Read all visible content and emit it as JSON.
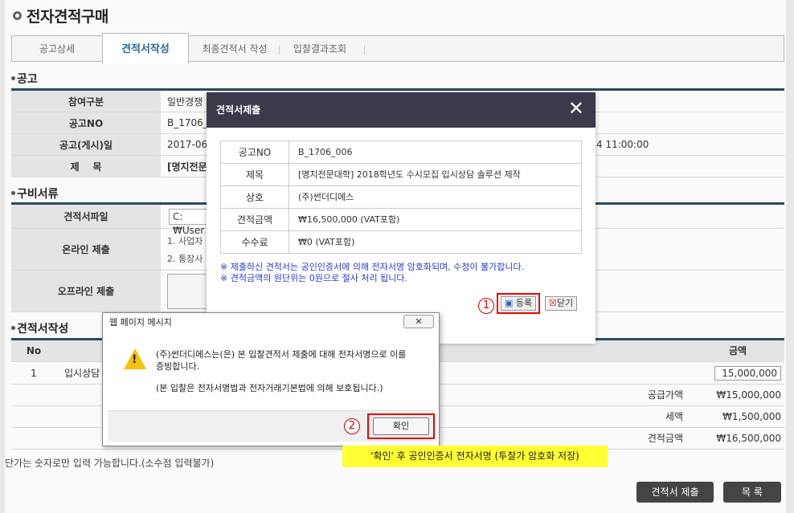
{
  "page": {
    "title": "전자견적구매"
  },
  "tabs": [
    {
      "label": "공고상세"
    },
    {
      "label": "견적서작성"
    },
    {
      "label": "최종견적서 작성"
    },
    {
      "label": "입찰결과조회"
    }
  ],
  "notice_section": {
    "heading": "공고",
    "rows": [
      {
        "label": "참여구분",
        "value": "일반경쟁"
      },
      {
        "label": "공고NO",
        "value": "B_1706_"
      },
      {
        "label": "공고(게시)일",
        "value": "2017-06",
        "extra": "4 11:00:00"
      },
      {
        "label": "제    목",
        "value": "[명지전문"
      }
    ]
  },
  "docs_section": {
    "heading": "구비서류",
    "rows": [
      {
        "label": "견적서파일",
        "value": "C:₩User"
      },
      {
        "label": "온라인 제출",
        "value1": "1. 사업자",
        "value2": "2. 통장사"
      },
      {
        "label": "오프라인 제출",
        "value": ""
      }
    ]
  },
  "quote_section": {
    "heading": "견적서작성",
    "col_no": "No",
    "col_amount": "금액",
    "row_no": "1",
    "row_item": "입시상담 솔",
    "row_amount": "15,000,000",
    "supply_label": "공급가액",
    "supply_value": "₩15,000,000",
    "tax_label": "세액",
    "tax_value": "₩1,500,000",
    "total_label": "견적금액",
    "total_value": "₩16,500,000"
  },
  "footnote": "단가는 숫자로만 입력 가능합니다.(소수점 입력불가)",
  "bottom_buttons": {
    "submit": "견적서 제출",
    "list": "목 록"
  },
  "modal": {
    "title": "견적서제출",
    "close": "✕",
    "rows": [
      {
        "label": "공고NO",
        "value": "B_1706_006"
      },
      {
        "label": "제목",
        "value": "[명지전문대학] 2018학년도 수시모집 입시상담 솔루션 제작"
      },
      {
        "label": "상호",
        "value": "(주)썬더디에스"
      },
      {
        "label": "견적금액",
        "value": "₩16,500,000 (VAT포함)"
      },
      {
        "label": "수수료",
        "value": "₩0 (VAT포함)"
      }
    ],
    "notice1": "※ 제출하신 견적서는 공인인증서에 의해 전자서명 암호화되며, 수정이 불가합니다.",
    "notice2": "※ 견적금액의 원단위는 0원으로 절사 처리 됩니다.",
    "register": "등록",
    "close_btn": "닫기",
    "step1": "1"
  },
  "dialog": {
    "title": "웹 페이지 메시지",
    "close": "✕",
    "line1": "(주)썬더디에스는(은) 본 입찰견적서 제출에 대해 전자서명으로 이를",
    "line2": "증빙합니다.",
    "line3": "(본 입찰은 전자서명법과 전자거래기본법에 의해 보호됩니다.)",
    "ok": "확인",
    "step2": "2"
  },
  "tooltip": "'확인' 후 공인인증서 전자서명 (투찰가 암호화 저장)"
}
